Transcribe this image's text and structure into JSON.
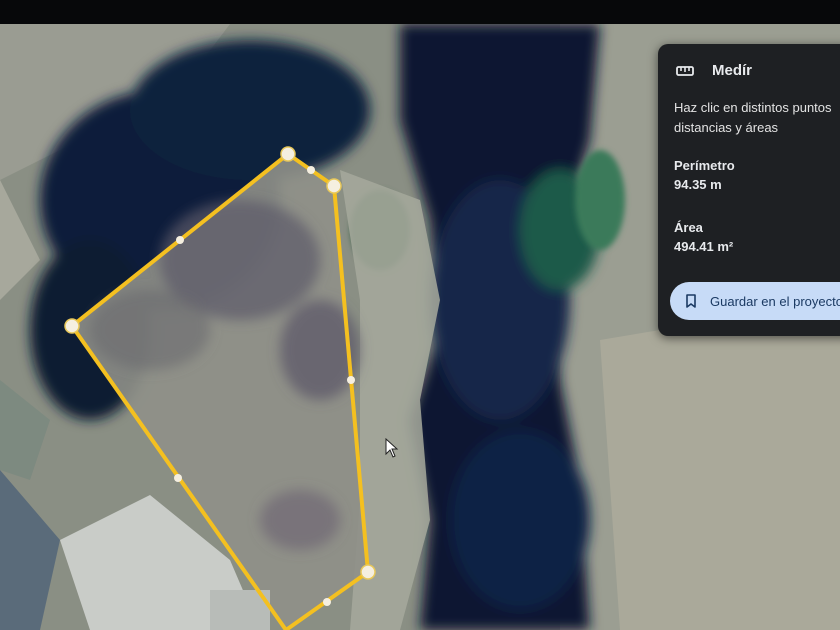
{
  "measure_panel": {
    "title": "Medír",
    "description_line1": "Haz clic en distintos puntos",
    "description_line2": "distancias y áreas",
    "perimeter_label": "Perímetro",
    "perimeter_value": "94.35 m",
    "area_label": "Área",
    "area_value": "494.41 m²",
    "save_button_label": "Guardar en el proyecto"
  },
  "icons": {
    "measure": "ruler-icon",
    "save": "bookmark-icon",
    "cursor": "mouse-pointer-icon"
  },
  "colors": {
    "polygon_stroke": "#f4c020",
    "vertex_fill": "#f5efe0",
    "panel_background": "#1e2023",
    "button_background": "#c7dbf7"
  }
}
